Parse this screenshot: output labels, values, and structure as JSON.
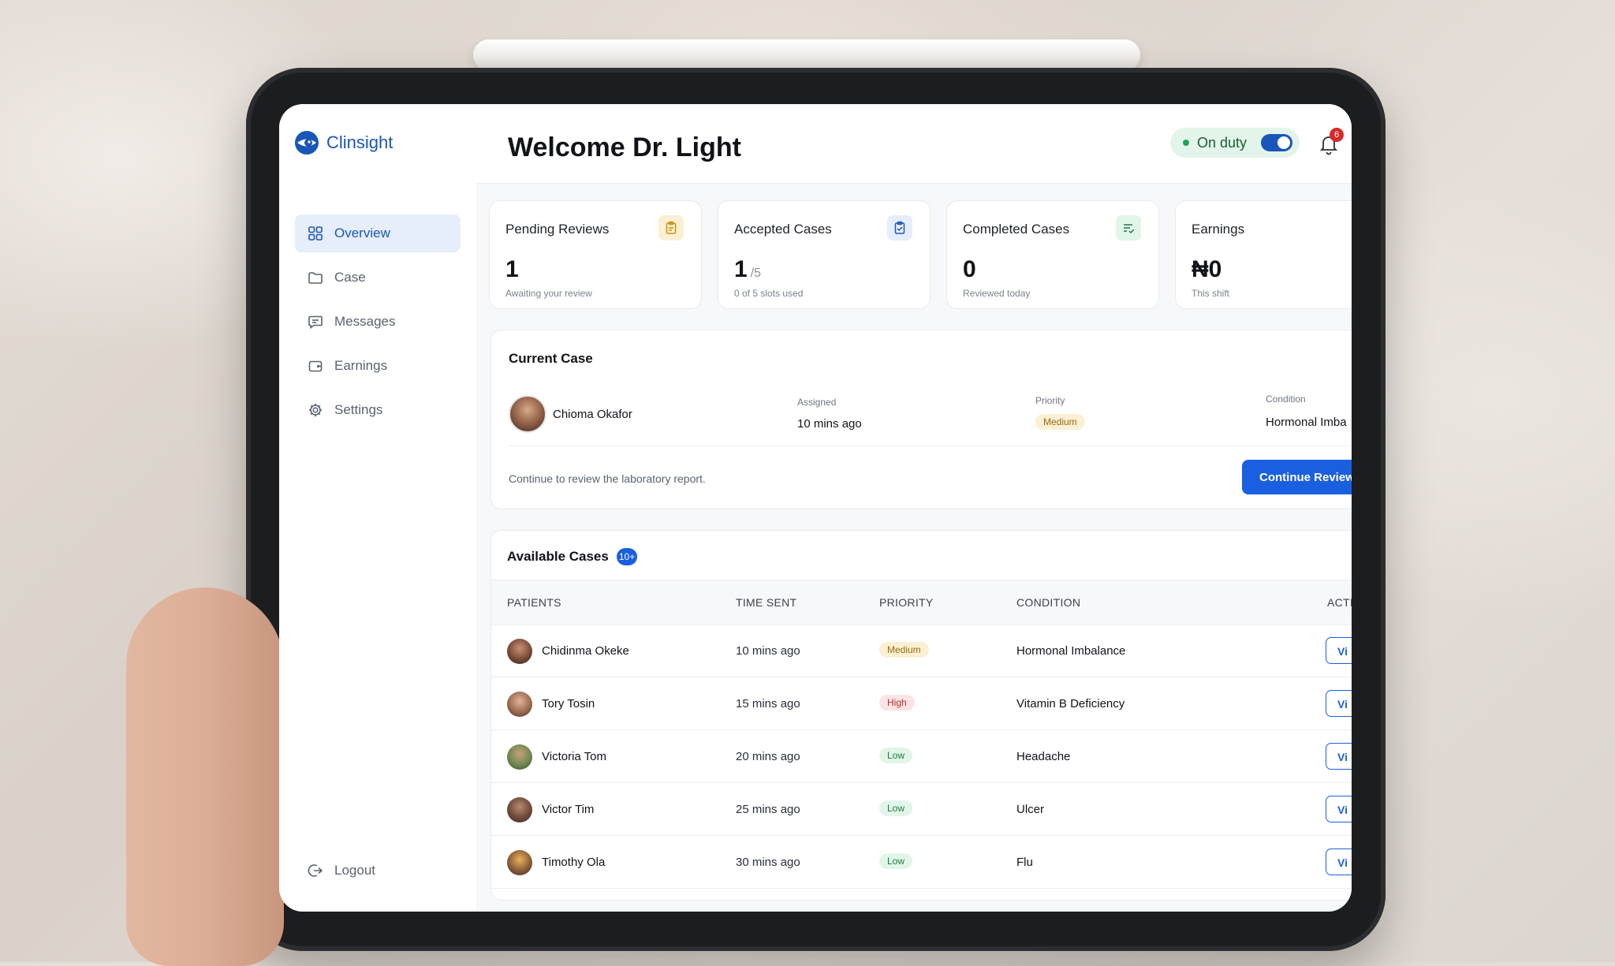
{
  "brand": {
    "name": "Clinsight",
    "accent": "#1a56b8"
  },
  "sidebar": {
    "items": [
      {
        "label": "Overview",
        "icon": "grid-icon",
        "active": true
      },
      {
        "label": "Case",
        "icon": "folder-icon",
        "active": false
      },
      {
        "label": "Messages",
        "icon": "message-icon",
        "active": false
      },
      {
        "label": "Earnings",
        "icon": "wallet-icon",
        "active": false
      },
      {
        "label": "Settings",
        "icon": "gear-icon",
        "active": false
      }
    ],
    "logout_label": "Logout"
  },
  "header": {
    "title": "Welcome Dr. Light",
    "duty_label": "On duty",
    "notification_count": "6"
  },
  "stats": [
    {
      "label": "Pending Reviews",
      "value": "1",
      "sub": "Awaiting your review",
      "icon": "clipboard-icon",
      "icon_bg": "#fbf0d4",
      "icon_color": "#c9920f"
    },
    {
      "label": "Accepted Cases",
      "value": "1",
      "of": "/5",
      "sub": "0 of 5 slots used",
      "icon": "clipboard-check-icon",
      "icon_bg": "#e6eefb",
      "icon_color": "#1a56b8"
    },
    {
      "label": "Completed Cases",
      "value": "0",
      "sub": "Reviewed today",
      "icon": "list-check-icon",
      "icon_bg": "#e2f5e9",
      "icon_color": "#1f7a44"
    },
    {
      "label": "Earnings",
      "value": "₦0",
      "sub": "This shift"
    }
  ],
  "current_case": {
    "title": "Current Case",
    "patient": "Chioma Okafor",
    "assigned_label": "Assigned",
    "assigned_value": "10 mins ago",
    "priority_label": "Priority",
    "priority_value": "Medium",
    "condition_label": "Condition",
    "condition_value": "Hormonal Imba",
    "note": "Continue to review the laboratory report.",
    "button_label": "Continue Review"
  },
  "available": {
    "title": "Available Cases",
    "count": "10+",
    "columns": [
      "PATIENTS",
      "TIME SENT",
      "PRIORITY",
      "CONDITION",
      "ACTI"
    ],
    "action_label": "Vi",
    "rows": [
      {
        "patient": "Chidinma Okeke",
        "time": "10 mins ago",
        "priority": "Medium",
        "condition": "Hormonal Imbalance"
      },
      {
        "patient": "Tory Tosin",
        "time": "15 mins ago",
        "priority": "High",
        "condition": "Vitamin B Deficiency"
      },
      {
        "patient": "Victoria Tom",
        "time": "20 mins ago",
        "priority": "Low",
        "condition": "Headache"
      },
      {
        "patient": "Victor Tim",
        "time": "25 mins ago",
        "priority": "Low",
        "condition": "Ulcer"
      },
      {
        "patient": "Timothy Ola",
        "time": "30 mins ago",
        "priority": "Low",
        "condition": "Flu"
      }
    ]
  }
}
